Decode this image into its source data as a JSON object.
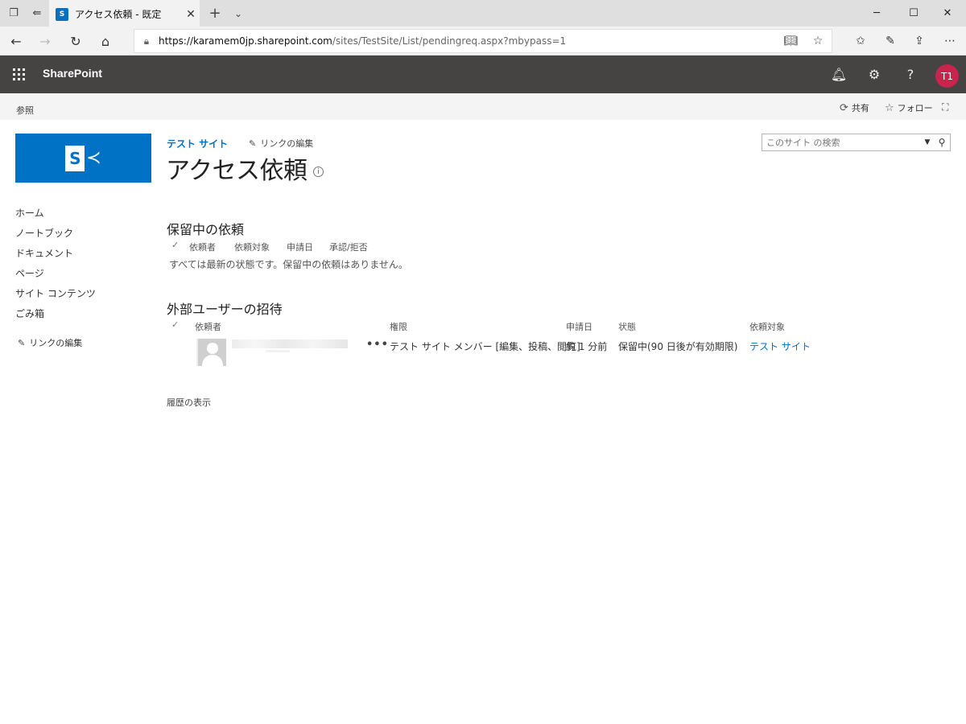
{
  "browser": {
    "tab_title": "アクセス依頼 - 既定",
    "tab_favicon": "S",
    "url_host": "https://karamem0jp.sharepoint.com",
    "url_path": "/sites/TestSite/List/pendingreq.aspx?mbypass=1"
  },
  "suite": {
    "brand": "SharePoint",
    "help_label": "?",
    "avatar_initials": "T1",
    "avatar_color": "#c7254e"
  },
  "ribbon": {
    "browse": "参照",
    "share": "共有",
    "follow": "フォロー"
  },
  "site": {
    "breadcrumb": "テスト サイト",
    "edit_links": "リンクの編集",
    "title": "アクセス依頼",
    "search_placeholder": "このサイト の検索",
    "logo_letter": "S",
    "accent_color": "#0072c6"
  },
  "leftnav": {
    "items": [
      "ホーム",
      "ノートブック",
      "ドキュメント",
      "ページ",
      "サイト コンテンツ",
      "ごみ箱"
    ],
    "edit_links": "リンクの編集"
  },
  "pending": {
    "title": "保留中の依頼",
    "columns": [
      "依頼者",
      "依頼対象",
      "申請日",
      "承認/拒否"
    ],
    "empty_message": "すべては最新の状態です。保留中の依頼はありません。"
  },
  "external": {
    "title": "外部ユーザーの招待",
    "columns": [
      "依頼者",
      "権限",
      "申請日",
      "状態",
      "依頼対象"
    ],
    "rows": [
      {
        "permission": "テスト サイト メンバー [編集、投稿、閲覧]",
        "requested": "約 1 分前",
        "status": "保留中(90 日後が有効期限)",
        "target": "テスト サイト"
      }
    ]
  },
  "history_link": "履歴の表示"
}
